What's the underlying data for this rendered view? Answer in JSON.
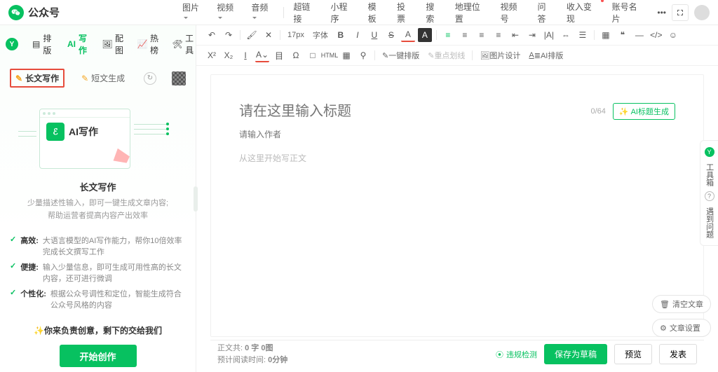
{
  "app": {
    "name": "公众号"
  },
  "topMenu": {
    "media": [
      "图片",
      "视频",
      "音频"
    ],
    "items": [
      "超链接",
      "小程序",
      "模板",
      "投票",
      "搜索",
      "地理位置",
      "视频号",
      "问答",
      "收入变现",
      "账号名片"
    ]
  },
  "toolbar1": {
    "fontSize": "17px",
    "fontFamily": "字体"
  },
  "toolbar2": {
    "quickLayout": "一键排版",
    "highlight": "重点划线",
    "imageDesign": "图片设计",
    "aiLayout": "AI排版"
  },
  "sideTabs": {
    "layout": "排版",
    "write": "写作",
    "image": "配图",
    "hot": "热榜",
    "tools": "工具"
  },
  "writingTabs": {
    "long": "长文写作",
    "short": "短文生成"
  },
  "illus": {
    "label": "AI写作"
  },
  "feature": {
    "title": "长文写作",
    "sub1": "少量描述性输入，即可一键生成文章内容;",
    "sub2": "帮助运营者提高内容产出效率"
  },
  "bullets": [
    {
      "label": "高效:",
      "text": "大语言模型的AI写作能力，帮你10倍效率完成长文撰写工作"
    },
    {
      "label": "便捷:",
      "text": "输入少量信息，即可生成可用性高的长文内容，还可进行微调"
    },
    {
      "label": "个性化:",
      "text": "根据公众号调性和定位，智能生成符合公众号风格的内容"
    }
  ],
  "slogan": "你来负责创意，剩下的交给我们",
  "startBtn": "开始创作",
  "editor": {
    "titlePlaceholder": "请在这里输入标题",
    "titleCount": "0/64",
    "aiTitleBtn": "AI标题生成",
    "authorPlaceholder": "请输入作者",
    "bodyPlaceholder": "从这里开始写正文"
  },
  "footer": {
    "wordLabel": "正文共:",
    "wordValue": "0 字 0图",
    "readLabel": "预计阅读时间:",
    "readValue": "0分钟",
    "violate": "违规检测",
    "saveDraft": "保存为草稿",
    "preview": "预览",
    "publish": "发表"
  },
  "dock": {
    "toolbox": "工具箱",
    "feedback": "遇到问题"
  },
  "floats": {
    "clear": "清空文章",
    "settings": "文章设置"
  }
}
